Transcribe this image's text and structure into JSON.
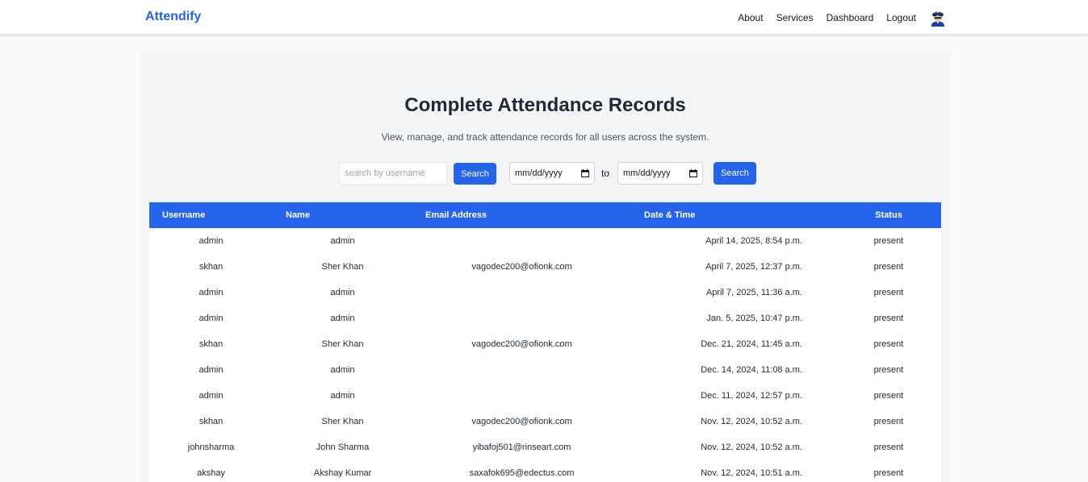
{
  "navbar": {
    "brand": "Attendify",
    "links": [
      "About",
      "Services",
      "Dashboard",
      "Logout"
    ],
    "avatar_icon": "police-officer-avatar-icon"
  },
  "header": {
    "title": "Complete Attendance Records",
    "subtitle": "View, manage, and track attendance records for all users across the system."
  },
  "filters": {
    "search_placeholder": "search by username",
    "search_button": "Search",
    "date_from": "mm/dd/yyyy",
    "to_label": "to",
    "date_to": "mm/dd/yyyy",
    "date_search_button": "Search"
  },
  "table": {
    "columns": [
      "Username",
      "Name",
      "Email Address",
      "Date & Time",
      "Status"
    ],
    "rows": [
      [
        "admin",
        "admin",
        "",
        "April 14, 2025, 8:54 p.m.",
        "present"
      ],
      [
        "skhan",
        "Sher Khan",
        "vagodec200@ofionk.com",
        "April 7, 2025, 12:37 p.m.",
        "present"
      ],
      [
        "admin",
        "admin",
        "",
        "April 7, 2025, 11:36 a.m.",
        "present"
      ],
      [
        "admin",
        "admin",
        "",
        "Jan. 5, 2025, 10:47 p.m.",
        "present"
      ],
      [
        "skhan",
        "Sher Khan",
        "vagodec200@ofionk.com",
        "Dec. 21, 2024, 11:45 a.m.",
        "present"
      ],
      [
        "admin",
        "admin",
        "",
        "Dec. 14, 2024, 11:08 a.m.",
        "present"
      ],
      [
        "admin",
        "admin",
        "",
        "Dec. 11, 2024, 12:57 p.m.",
        "present"
      ],
      [
        "skhan",
        "Sher Khan",
        "vagodec200@ofionk.com",
        "Nov. 12, 2024, 10:52 a.m.",
        "present"
      ],
      [
        "johnsharma",
        "John Sharma",
        "yibafoj501@rinseart.com",
        "Nov. 12, 2024, 10:52 a.m.",
        "present"
      ],
      [
        "akshay",
        "Akshay Kumar",
        "saxafok695@edectus.com",
        "Nov. 12, 2024, 10:51 a.m.",
        "present"
      ]
    ]
  },
  "colors": {
    "accent": "#2563eb",
    "panel_bg": "#f3f4f6",
    "page_bg": "#f8fafc"
  }
}
